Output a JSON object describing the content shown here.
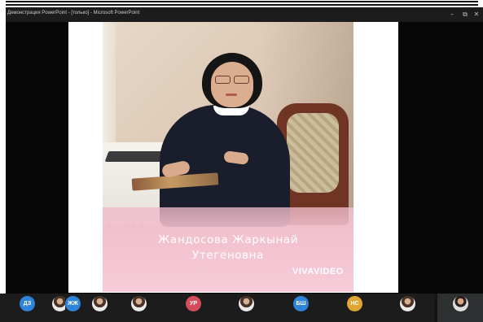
{
  "window": {
    "title": "Демонстрация PowerPoint - [только] - Microsoft PowerPoint",
    "controls": {
      "minimize": "–",
      "restore": "⧉",
      "close": "✕"
    }
  },
  "slide": {
    "name_line1": "Жандосова Жаркынай",
    "name_line2": "Утегеновна",
    "watermark": "VIVAVIDEO"
  },
  "participants": [
    {
      "type": "initials",
      "initials": "ДЗ",
      "color": "#2f84d9",
      "name": ""
    },
    {
      "type": "photo",
      "name": ""
    },
    {
      "type": "initials",
      "initials": "ЖЖ",
      "color": "#2f84d9",
      "name": ""
    },
    {
      "type": "photo",
      "name": ""
    },
    {
      "type": "photo",
      "name": ""
    },
    {
      "type": "initials",
      "initials": "УР",
      "color": "#d54d5b",
      "name": ""
    },
    {
      "type": "photo",
      "name": ""
    },
    {
      "type": "initials",
      "initials": "БШ",
      "color": "#2f84d9",
      "name": ""
    },
    {
      "type": "initials",
      "initials": "НС",
      "color": "#e0a532",
      "name": ""
    },
    {
      "type": "photo",
      "name": ""
    },
    {
      "type": "photo",
      "name": ""
    }
  ],
  "colors": {
    "screen_bg": "#070707",
    "overlay_pink": "#f3c2d0",
    "blue_avatar": "#2f84d9",
    "red_avatar": "#d54d5b",
    "orange_avatar": "#e0a532"
  }
}
